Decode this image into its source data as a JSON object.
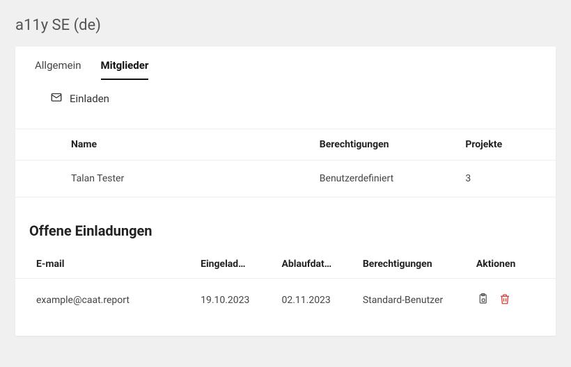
{
  "header": {
    "title": "a11y SE (de)"
  },
  "tabs": [
    {
      "label": "Allgemein",
      "active": false
    },
    {
      "label": "Mitglieder",
      "active": true
    }
  ],
  "invite_action": {
    "label": "Einladen"
  },
  "members_table": {
    "columns": {
      "name": "Name",
      "permissions": "Berechtigungen",
      "projects": "Projekte"
    },
    "rows": [
      {
        "name": "Talan Tester",
        "permissions": "Benutzerdefiniert",
        "projects": "3"
      }
    ]
  },
  "open_invitations": {
    "title": "Offene Einladungen",
    "columns": {
      "email": "E-mail",
      "invited": "Eingelad…",
      "expires": "Ablaufdat…",
      "permissions": "Berechtigungen",
      "actions": "Aktionen"
    },
    "rows": [
      {
        "email": "example@caat.report",
        "invited": "19.10.2023",
        "expires": "02.11.2023",
        "permissions": "Standard-Benutzer"
      }
    ]
  }
}
